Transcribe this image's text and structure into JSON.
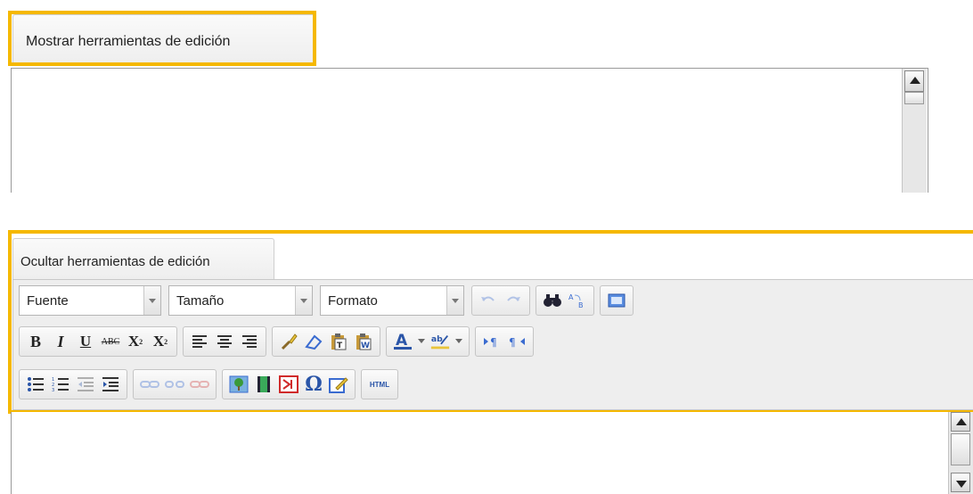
{
  "top_editor": {
    "tab_label": "Mostrar herramientas de edición"
  },
  "bottom_editor": {
    "tab_label": "Ocultar herramientas de edición",
    "combos": {
      "font": "Fuente",
      "size": "Tamaño",
      "format": "Formato"
    },
    "row2": {
      "bold": "B",
      "italic": "I",
      "underline": "U",
      "strike": "ABC",
      "subscript": "X",
      "superscript": "X"
    },
    "row3": {
      "html_button": "HTML"
    }
  },
  "colors": {
    "highlight": "#f5b800",
    "toolbar_bg": "#eeeeee"
  }
}
